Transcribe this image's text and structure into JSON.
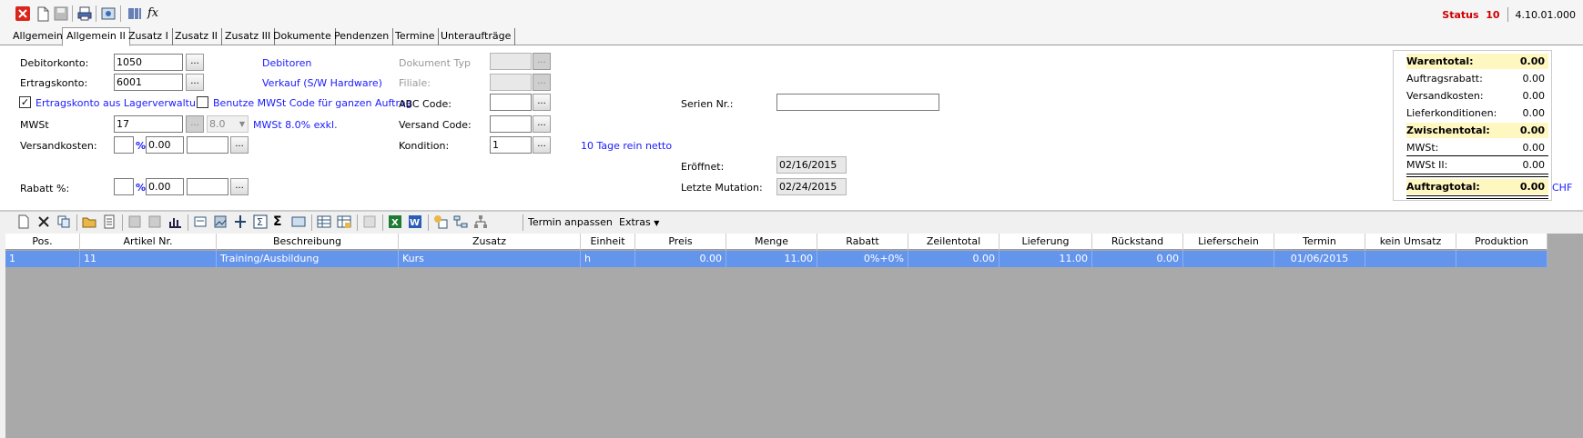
{
  "status": {
    "label": "Status",
    "value": "10",
    "version": "4.10.01.000"
  },
  "tabs": [
    "Allgemein",
    "Allgemein II",
    "Zusatz I",
    "Zusatz II",
    "Zusatz III",
    "Dokumente",
    "Pendenzen",
    "Termine",
    "Unteraufträge"
  ],
  "form": {
    "debitorkonto_label": "Debitorkonto:",
    "debitorkonto_value": "1050",
    "debitorkonto_desc": "Debitoren",
    "ertragskonto_label": "Ertragskonto:",
    "ertragskonto_value": "6001",
    "ertragskonto_desc": "Verkauf (S/W  Hardware)",
    "ertragskonto_check_label": "Ertragskonto aus Lagerverwaltung",
    "mwst_code_check_label": "Benutze MWSt Code für ganzen Auftrag",
    "mwst_label": "MWSt",
    "mwst_value": "17",
    "mwst_rate": "8.0",
    "mwst_desc": "MWSt 8.0% exkl.",
    "versandkosten_label": "Versandkosten:",
    "versandkosten_value": "0.00",
    "pct_symbol": "%",
    "rabatt_label": "Rabatt %:",
    "rabatt_value": "0.00",
    "dokument_typ_label": "Dokument Typ",
    "filiale_label": "Filiale:",
    "abc_code_label": "ABC Code:",
    "versand_code_label": "Versand Code:",
    "kondition_label": "Kondition:",
    "kondition_value": "1",
    "kondition_desc": "10 Tage rein netto",
    "serien_label": "Serien Nr.:",
    "eroeffnet_label": "Eröffnet:",
    "eroeffnet_value": "02/16/2015",
    "mutation_label": "Letzte Mutation:",
    "mutation_value": "02/24/2015",
    "dots": "..."
  },
  "totals": {
    "warentotal_label": "Warentotal:",
    "warentotal": "0.00",
    "auftragsrabatt_label": "Auftragsrabatt:",
    "auftragsrabatt": "0.00",
    "versandkosten_label": "Versandkosten:",
    "versandkosten": "0.00",
    "lieferkonditionen_label": "Lieferkonditionen:",
    "lieferkonditionen": "0.00",
    "zwischentotal_label": "Zwischentotal:",
    "zwischentotal": "0.00",
    "mwst_label": "MWSt:",
    "mwst": "0.00",
    "mwst2_label": "MWSt II:",
    "mwst2": "0.00",
    "auftragtotal_label": "Auftragtotal:",
    "auftragtotal": "0.00",
    "currency": "CHF"
  },
  "toolbar2": {
    "termin_anpassen": "Termin anpassen",
    "extras": "Extras"
  },
  "grid": {
    "columns": [
      "Pos.",
      "Artikel Nr.",
      "Beschreibung",
      "Zusatz",
      "Einheit",
      "Preis",
      "Menge",
      "Rabatt",
      "Zeilentotal",
      "Lieferung",
      "Rückstand",
      "Lieferschein",
      "Termin",
      "kein Umsatz",
      "Produktion"
    ],
    "rows": [
      [
        "1",
        "11",
        "Training/Ausbildung",
        "Kurs",
        "h",
        "0.00",
        "11.00",
        "0%+0%",
        "0.00",
        "11.00",
        "0.00",
        "",
        "01/06/2015",
        "",
        ""
      ]
    ]
  }
}
